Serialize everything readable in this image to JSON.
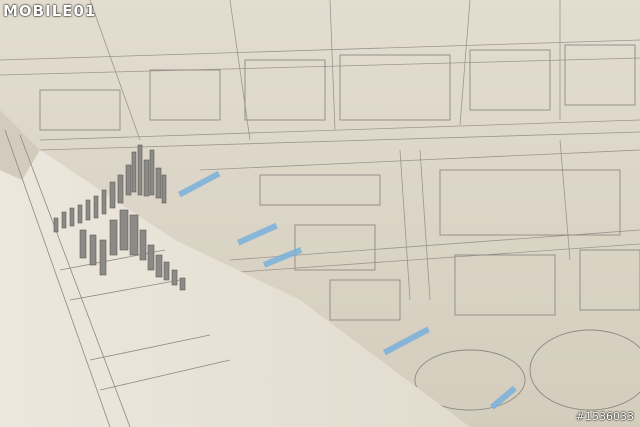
{
  "watermark": {
    "logo_text": "MOBILE01",
    "photo_id": "#1536033"
  },
  "colors": {
    "paper": "#e9e4da",
    "paper_shadow": "#c9c1b1",
    "lines": "#8d8a84",
    "highlight": "#7fb3da",
    "model": "#8c8a86"
  }
}
